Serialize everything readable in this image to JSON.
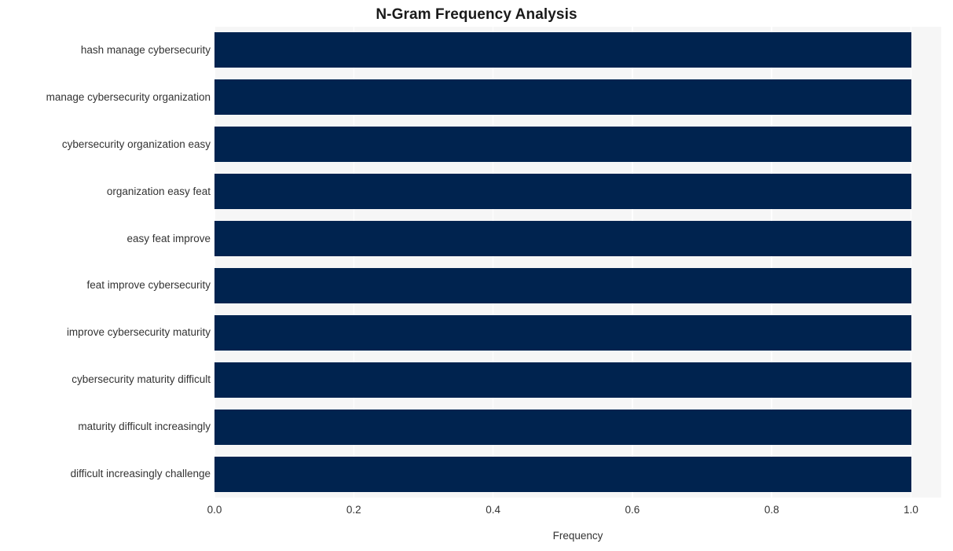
{
  "chart_data": {
    "type": "bar",
    "orientation": "horizontal",
    "title": "N-Gram Frequency Analysis",
    "xlabel": "Frequency",
    "ylabel": "",
    "categories": [
      "hash manage cybersecurity",
      "manage cybersecurity organization",
      "cybersecurity organization easy",
      "organization easy feat",
      "easy feat improve",
      "feat improve cybersecurity",
      "improve cybersecurity maturity",
      "cybersecurity maturity difficult",
      "maturity difficult increasingly",
      "difficult increasingly challenge"
    ],
    "values": [
      1.0,
      1.0,
      1.0,
      1.0,
      1.0,
      1.0,
      1.0,
      1.0,
      1.0,
      1.0
    ],
    "xlim": [
      0.0,
      1.0434
    ],
    "xticks": [
      0.0,
      0.2,
      0.4,
      0.6,
      0.8,
      1.0
    ],
    "xtick_labels": [
      "0.0",
      "0.2",
      "0.4",
      "0.6",
      "0.8",
      "1.0"
    ],
    "grid": true,
    "grid_axis": "x",
    "legend": false,
    "bar_color": "#00234f",
    "plot_background": "#f6f6f6",
    "gridline_color": "#ffffff",
    "figure_background": "#ffffff"
  }
}
